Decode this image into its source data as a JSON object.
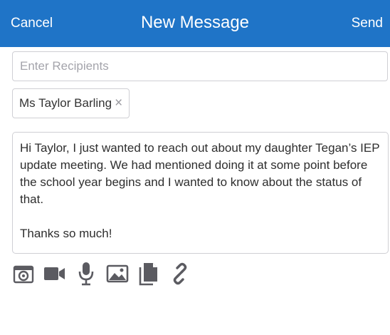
{
  "nav": {
    "cancel_label": "Cancel",
    "title": "New Message",
    "send_label": "Send",
    "background": "#1f74c7"
  },
  "recipients": {
    "placeholder": "Enter Recipients"
  },
  "chip": {
    "name": "Ms Taylor Barling",
    "remove_symbol": "×"
  },
  "message": {
    "body": "Hi Taylor, I just wanted to reach out about my daughter Tegan’s IEP update meeting. We had mentioned doing it at some point before the school year begins and I wanted to know about the status of that.\n\nThanks so much!"
  },
  "toolbar": {
    "icon_color": "#5b5b61",
    "icons": [
      "camera-icon",
      "video-icon",
      "microphone-icon",
      "image-icon",
      "document-icon",
      "link-icon"
    ]
  }
}
